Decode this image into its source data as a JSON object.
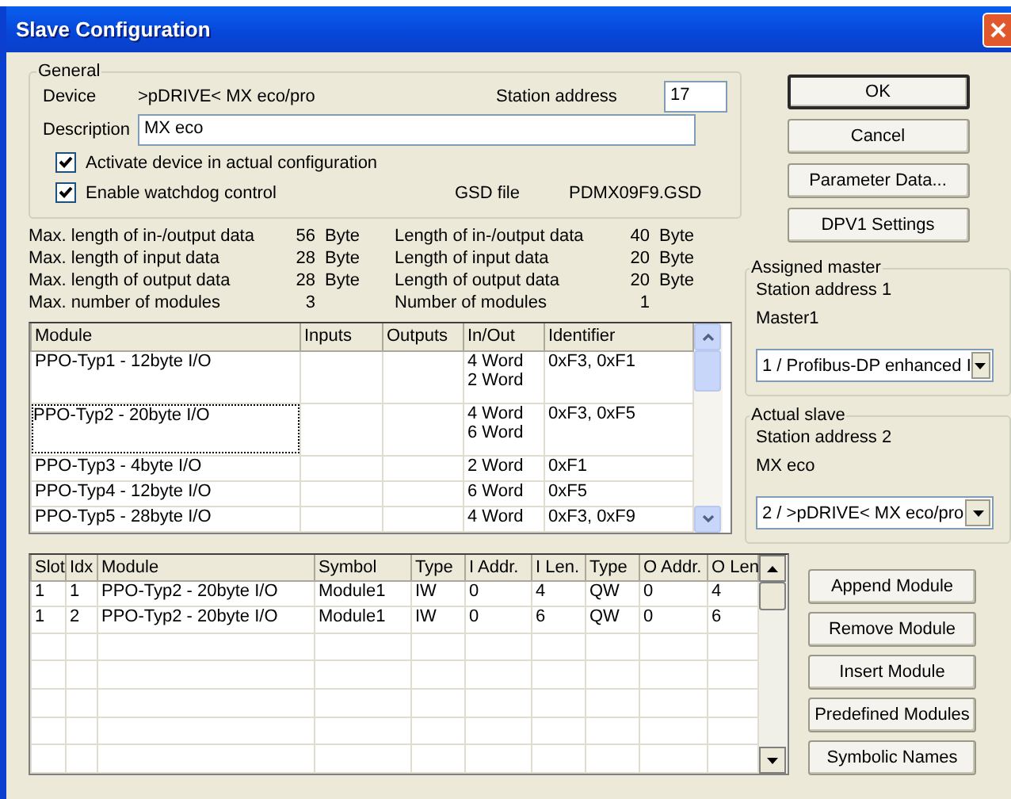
{
  "window": {
    "title": "Slave Configuration"
  },
  "general": {
    "legend": "General",
    "device_label": "Device",
    "device": ">pDRIVE< MX eco/pro",
    "station_label": "Station address",
    "station": "17",
    "description_label": "Description",
    "description": "MX eco",
    "checkboxes": [
      {
        "label": "Activate device in actual configuration",
        "checked": true
      },
      {
        "label": "Enable watchdog control",
        "checked": true
      }
    ],
    "gsd_label": "GSD file",
    "gsd": "PDMX09F9.GSD"
  },
  "stats": [
    {
      "label": "Max. length of in-/output data",
      "value": "56",
      "unit": "Byte"
    },
    {
      "label": "Length of in-/output data",
      "value": "40",
      "unit": "Byte"
    },
    {
      "label": "Max. length of input data",
      "value": "28",
      "unit": "Byte"
    },
    {
      "label": "Length of input data",
      "value": "20",
      "unit": "Byte"
    },
    {
      "label": "Max. length of output data",
      "value": "28",
      "unit": "Byte"
    },
    {
      "label": "Length of output data",
      "value": "20",
      "unit": "Byte"
    },
    {
      "label": "Max. number of modules",
      "value": "3"
    },
    {
      "label": "Number of modules",
      "value": "1"
    }
  ],
  "modules": {
    "columns": [
      "Module",
      "Inputs",
      "Outputs",
      "In/Out",
      "Identifier"
    ],
    "rows": [
      {
        "module": "PPO-Typ1 - 12byte I/O",
        "in_out": [
          "4 Word",
          "2 Word"
        ],
        "identifier": "0xF3, 0xF1",
        "selected": false
      },
      {
        "module": "PPO-Typ2 - 20byte I/O",
        "in_out": [
          "4 Word",
          "6 Word"
        ],
        "identifier": "0xF3, 0xF5",
        "selected": true
      },
      {
        "module": "PPO-Typ3 - 4byte I/O",
        "in_out": [
          "2 Word"
        ],
        "identifier": "0xF1",
        "selected": false
      },
      {
        "module": "PPO-Typ4 - 12byte I/O",
        "in_out": [
          "6 Word"
        ],
        "identifier": "0xF5",
        "selected": false
      },
      {
        "module": "PPO-Typ5 - 28byte I/O",
        "in_out": [
          "4 Word"
        ],
        "identifier": "0xF3, 0xF9",
        "selected": false
      }
    ]
  },
  "buttons": [
    {
      "label": "OK",
      "default": true
    },
    {
      "label": "Cancel",
      "default": false
    },
    {
      "label": "Parameter Data...",
      "default": false
    },
    {
      "label": "DPV1 Settings",
      "default": false
    }
  ],
  "assigned_master": {
    "legend": "Assigned master",
    "station": "Station address 1",
    "name": "Master1",
    "select": "1 / Profibus-DP enhanced I"
  },
  "actual_slave": {
    "legend": "Actual slave",
    "station": "Station address 2",
    "name": "MX eco",
    "select": "2 / >pDRIVE< MX eco/pro"
  },
  "slots": {
    "columns": [
      "Slot",
      "Idx",
      "Module",
      "Symbol",
      "Type",
      "I Addr.",
      "I Len.",
      "Type",
      "O Addr.",
      "O Len"
    ],
    "rows": [
      [
        "1",
        "1",
        "PPO-Typ2 - 20byte I/O",
        "Module1",
        "IW",
        "0",
        "4",
        "QW",
        "0",
        "4"
      ],
      [
        "1",
        "2",
        "PPO-Typ2 - 20byte I/O",
        "Module1",
        "IW",
        "0",
        "6",
        "QW",
        "0",
        "6"
      ]
    ]
  },
  "module_buttons": [
    "Append Module",
    "Remove Module",
    "Insert Module",
    "Predefined Modules",
    "Symbolic Names"
  ]
}
